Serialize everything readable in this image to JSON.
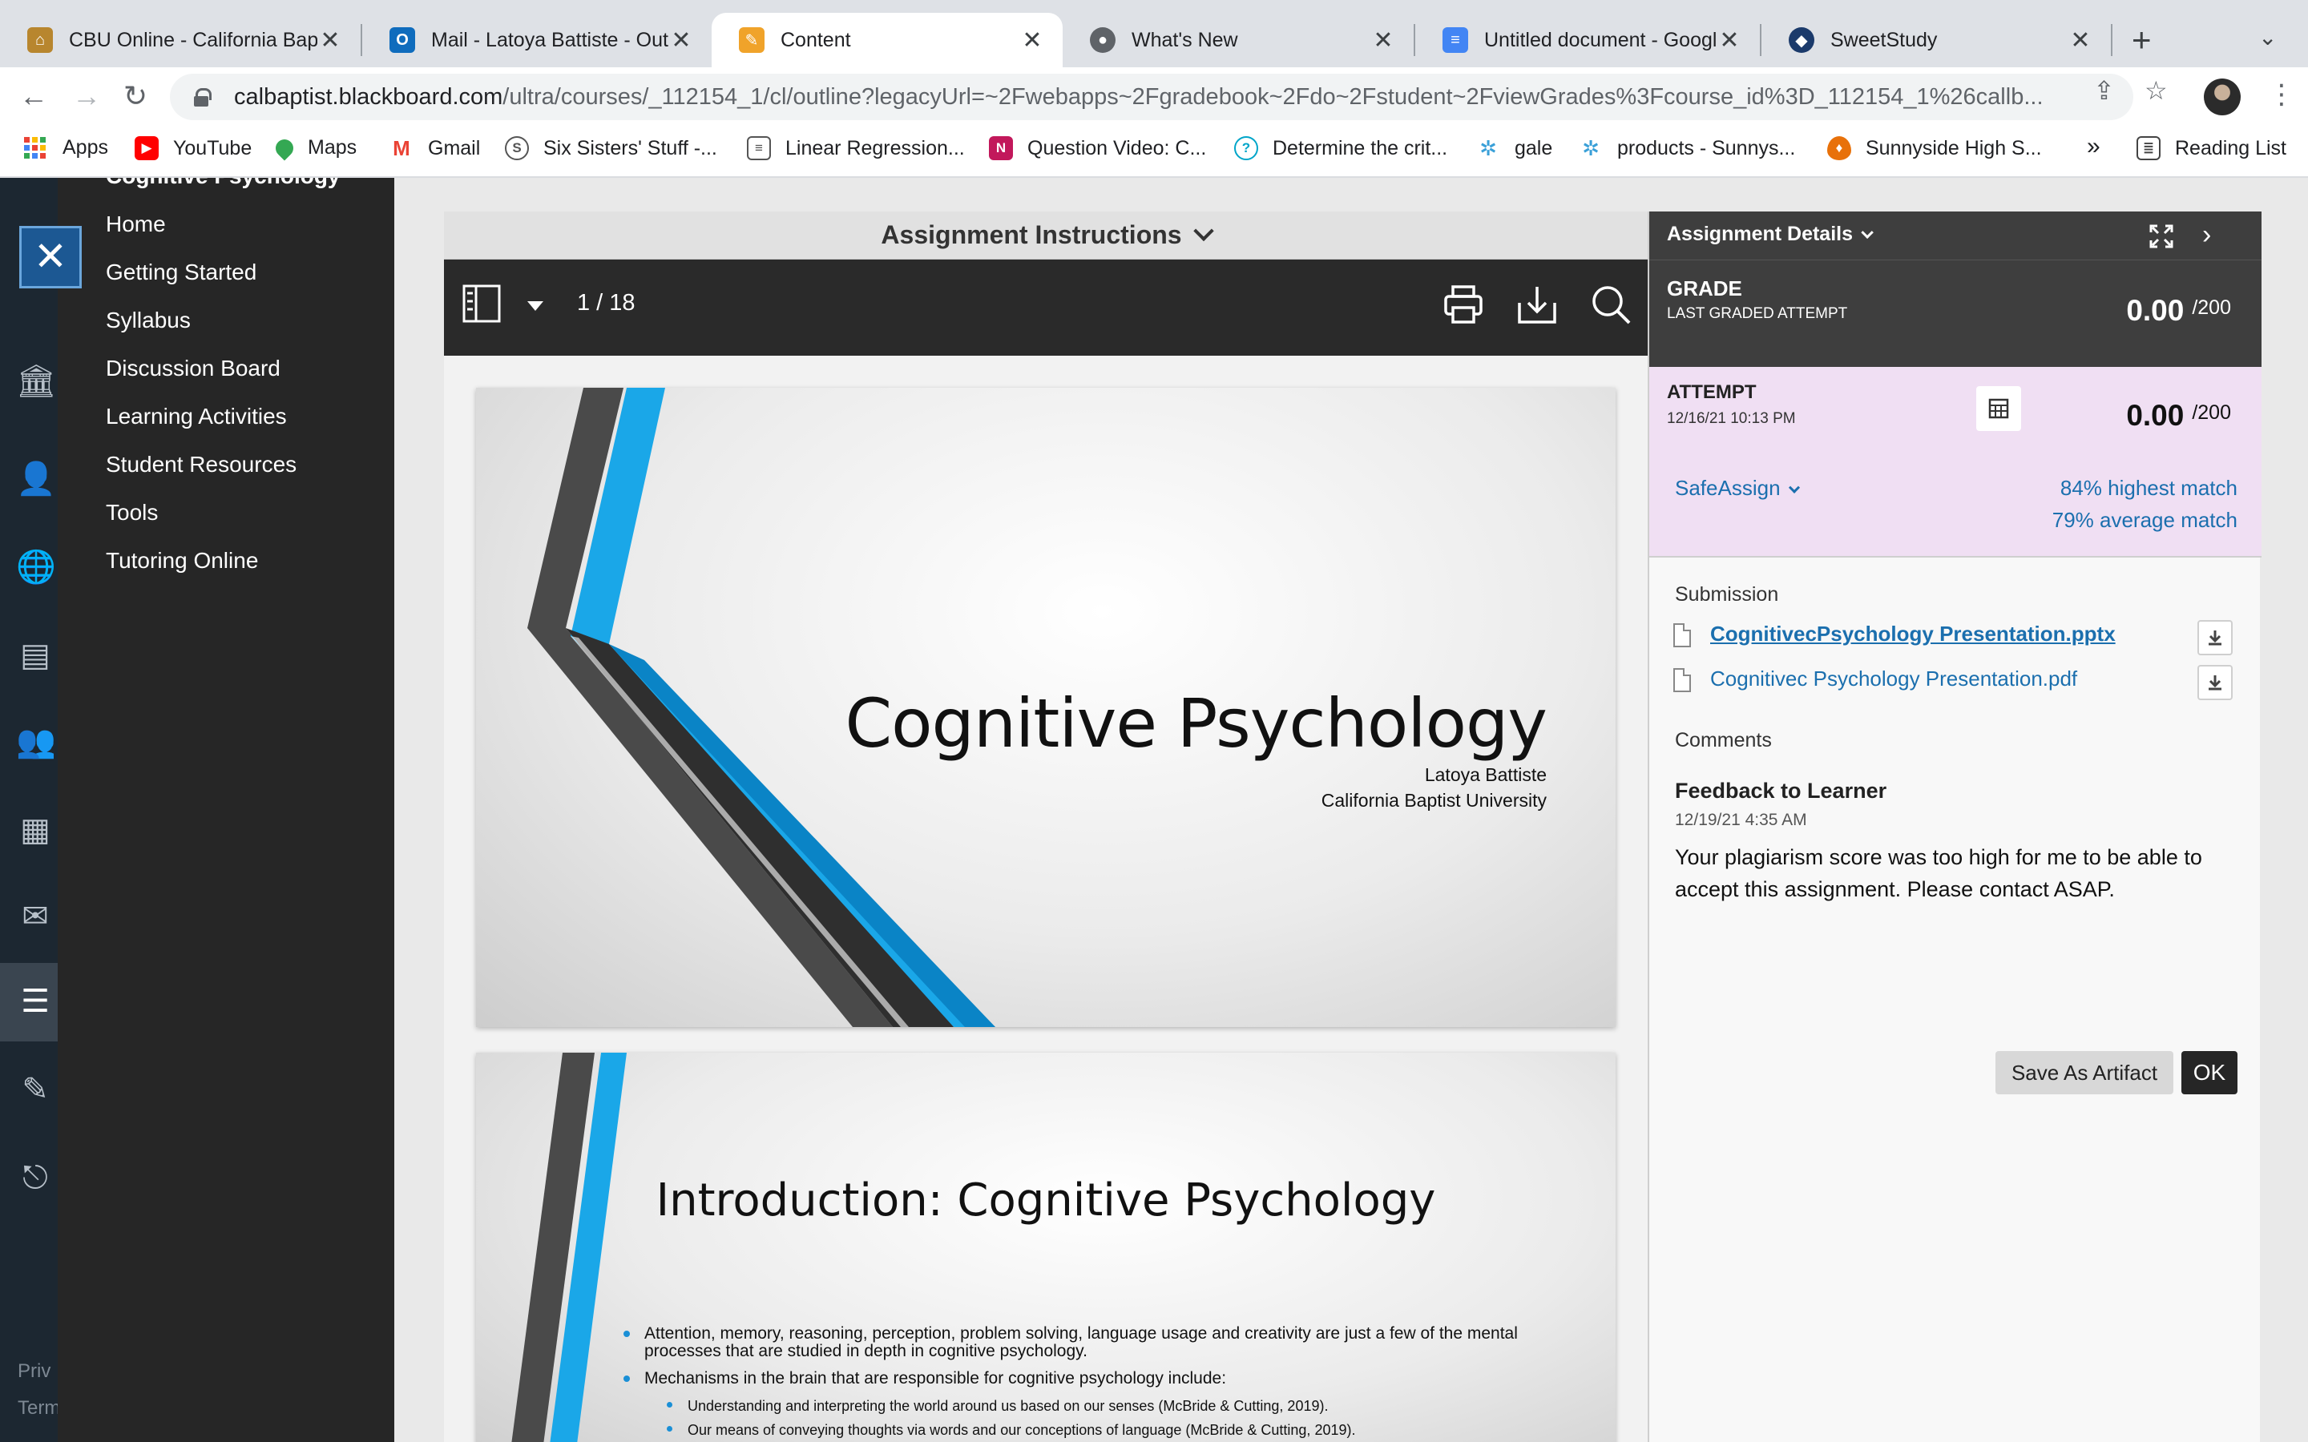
{
  "browser": {
    "tabs": [
      {
        "title": "CBU Online - California Bap",
        "icon": "cbu-favicon",
        "color": "#b8862e",
        "active": false
      },
      {
        "title": "Mail - Latoya Battiste - Out",
        "icon": "outlook-favicon",
        "color": "#0f6cbd",
        "active": false
      },
      {
        "title": "Content",
        "icon": "blackboard-favicon",
        "color": "#f0a32a",
        "active": true
      },
      {
        "title": "What's New",
        "icon": "chrome-favicon",
        "color": "#5f6368",
        "active": false
      },
      {
        "title": "Untitled document - Google",
        "icon": "google-docs-favicon",
        "color": "#4285f4",
        "active": false
      },
      {
        "title": "SweetStudy",
        "icon": "sweetstudy-favicon",
        "color": "#1b3a6b",
        "active": false
      }
    ],
    "tab_close": "✕",
    "new_tab": "+",
    "url_host": "calbaptist.blackboard.com",
    "url_path": "/ultra/courses/_112154_1/cl/outline?legacyUrl=~2Fwebapps~2Fgradebook~2Fdo~2Fstudent~2FviewGrades%3Fcourse_id%3D_112154_1%26callb...",
    "bookmarks": [
      {
        "label": "Apps",
        "icon": "apps-grid-icon"
      },
      {
        "label": "YouTube",
        "icon": "youtube-icon",
        "color": "#ff0000"
      },
      {
        "label": "Maps",
        "icon": "maps-icon",
        "color": "#34a853"
      },
      {
        "label": "Gmail",
        "icon": "gmail-icon",
        "color": "#ea4335"
      },
      {
        "label": "Six Sisters' Stuff -...",
        "icon": "sixsisters-icon",
        "color": "#555555"
      },
      {
        "label": "Linear Regression...",
        "icon": "document-icon",
        "color": "#555555"
      },
      {
        "label": "Question Video: C...",
        "icon": "nagwa-icon",
        "color": "#c2185b"
      },
      {
        "label": "Determine the crit...",
        "icon": "question-icon",
        "color": "#00a5c9"
      },
      {
        "label": "gale",
        "icon": "gale-icon",
        "color": "#3aa0d8"
      },
      {
        "label": "products - Sunnys...",
        "icon": "gale-icon",
        "color": "#3aa0d8"
      },
      {
        "label": "Sunnyside High S...",
        "icon": "flame-icon",
        "color": "#e8710a"
      }
    ],
    "bookmarks_overflow": "»",
    "reading_list": "Reading List"
  },
  "course_menu": {
    "course_title": "Cognitive Psychology",
    "items": [
      "Home",
      "Getting Started",
      "Syllabus",
      "Discussion Board",
      "Learning Activities",
      "Student Resources",
      "Tools",
      "Tutoring Online"
    ]
  },
  "rail": {
    "close": "✕",
    "footer": [
      "Priv",
      "Term"
    ]
  },
  "viewer": {
    "instructions_title": "Assignment Instructions",
    "page_indicator": "1 / 18"
  },
  "slides": {
    "slide1": {
      "title": "Cognitive Psychology",
      "author": "Latoya Battiste",
      "school": "California Baptist University"
    },
    "slide2": {
      "title": "Introduction: Cognitive Psychology",
      "bullets": [
        "Attention, memory, reasoning, perception, problem solving, language usage and creativity are just a few of the mental processes that are studied in depth in cognitive psychology.",
        "Mechanisms in the brain that are responsible for cognitive psychology include:"
      ],
      "sub_bullets": [
        "Understanding and interpreting the world around us based on our senses (McBride & Cutting, 2019).",
        "Our means of conveying thoughts via words and our conceptions of language (McBride & Cutting, 2019)."
      ]
    }
  },
  "details": {
    "header": "Assignment Details",
    "grade_label": "GRADE",
    "grade_sub": "LAST GRADED ATTEMPT",
    "grade_score": "0.00",
    "grade_out_of": "/200",
    "attempt_label": "ATTEMPT",
    "attempt_date": "12/16/21 10:13 PM",
    "attempt_score": "0.00",
    "attempt_out_of": "/200",
    "safeassign": "SafeAssign",
    "highest_match": "84% highest match",
    "average_match": "79% average match",
    "submission_label": "Submission",
    "files": [
      "CognitivecPsychology Presentation.pptx",
      "Cognitivec Psychology Presentation.pdf"
    ],
    "comments_label": "Comments",
    "feedback_title": "Feedback to Learner",
    "feedback_date": "12/19/21 4:35 AM",
    "feedback_text": "Your plagiarism score was too high for me to be able to accept this assignment. Please contact ASAP.",
    "save_artifact": "Save As Artifact",
    "ok": "OK"
  },
  "colors": {
    "rail": "#1c2731",
    "course_menu": "#262626",
    "accent_link": "#1b6fae",
    "attempt_bg": "#f0dff3",
    "slide_blue": "#1a9ee0"
  }
}
